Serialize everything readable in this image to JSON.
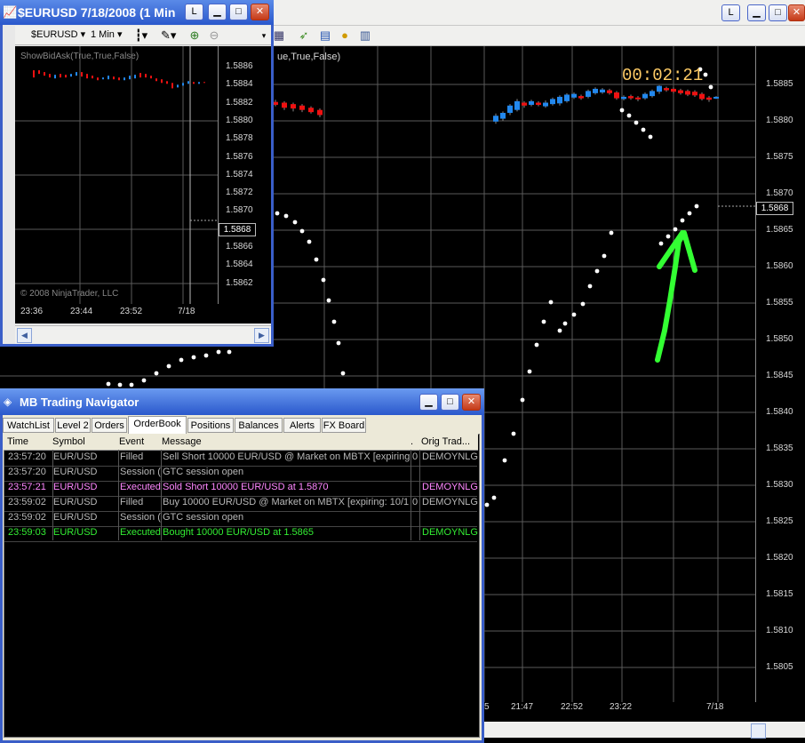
{
  "main_window": {
    "title_buttons": {
      "restore": "L"
    },
    "indicator_label": "ue,True,False)",
    "countdown": "00:02:21",
    "current_price": "1.5868",
    "price_axis": [
      "1.5885",
      "1.5880",
      "1.5875",
      "1.5870",
      "1.5865",
      "1.5860",
      "1.5855",
      "1.5850",
      "1.5845",
      "1.5840",
      "1.5835",
      "1.5830",
      "1.5825",
      "1.5820",
      "1.5815",
      "1.5810",
      "1.5805"
    ],
    "time_axis": [
      "21:47",
      "22:52",
      "23:22",
      "7/18"
    ],
    "time_axis_partial": "5"
  },
  "small_window": {
    "title": "$EURUSD  7/18/2008 (1 Min",
    "restore_label": "L",
    "instrument": "$EURUSD",
    "interval": "1 Min",
    "indicator_label": "ShowBidAsk(True,True,False)",
    "copyright": "© 2008 NinjaTrader, LLC",
    "current_price": "1.5868",
    "price_axis": [
      "1.5886",
      "1.5884",
      "1.5882",
      "1.5880",
      "1.5878",
      "1.5876",
      "1.5874",
      "1.5872",
      "1.5870",
      "1.5868",
      "1.5866",
      "1.5864",
      "1.5862"
    ],
    "time_axis": [
      "23:36",
      "23:44",
      "23:52",
      "7/18"
    ]
  },
  "navigator": {
    "title": "MB Trading Navigator",
    "tabs": [
      "WatchList",
      "Level 2",
      "Orders",
      "OrderBook",
      "Positions",
      "Balances",
      "Alerts",
      "FX Board"
    ],
    "active_tab": "OrderBook",
    "columns": [
      "Time",
      "Symbol",
      "Event",
      "Message",
      ".",
      "Orig Trad..."
    ],
    "rows": [
      {
        "time": "23:57:20",
        "symbol": "EUR/USD",
        "event": "Filled",
        "message": "Sell Short 10000 EUR/USD @ Market on MBTX [expiring:",
        "dot": "0",
        "orig": "DEMOYNLG",
        "color": "#b8b8b8"
      },
      {
        "time": "23:57:20",
        "symbol": "EUR/USD",
        "event": "Session (",
        "message": "    GTC session open",
        "dot": "",
        "orig": "",
        "color": "#b8b8b8"
      },
      {
        "time": "23:57:21",
        "symbol": "EUR/USD",
        "event": "Executed",
        "message": "    Sold Short 10000 EUR/USD at 1.5870",
        "dot": "",
        "orig": "DEMOYNLG",
        "color": "#ff88ff"
      },
      {
        "time": "23:59:02",
        "symbol": "EUR/USD",
        "event": "Filled",
        "message": "Buy 10000 EUR/USD @ Market on MBTX [expiring: 10/1",
        "dot": "0",
        "orig": "DEMOYNLG",
        "color": "#b8b8b8"
      },
      {
        "time": "23:59:02",
        "symbol": "EUR/USD",
        "event": "Session (",
        "message": "    GTC session open",
        "dot": "",
        "orig": "",
        "color": "#b8b8b8"
      },
      {
        "time": "23:59:03",
        "symbol": "EUR/USD",
        "event": "Executed",
        "message": "    Bought 10000 EUR/USD at 1.5865",
        "dot": "",
        "orig": "DEMOYNLG",
        "color": "#33ee33"
      }
    ]
  },
  "icons": [
    "chart-icon",
    "bar-style-icon",
    "pencil-icon",
    "zoom-in-icon",
    "zoom-out-icon",
    "data-box-icon",
    "indicator-icon",
    "strategy-icon",
    "coin-icon",
    "properties-icon",
    "navigator-icon"
  ],
  "colors": {
    "up_bar": "#2288ee",
    "down_bar": "#ee1111",
    "psar_dot": "#ffffff",
    "annotation": "#33ff33",
    "titlebar": "#2a58cc"
  }
}
